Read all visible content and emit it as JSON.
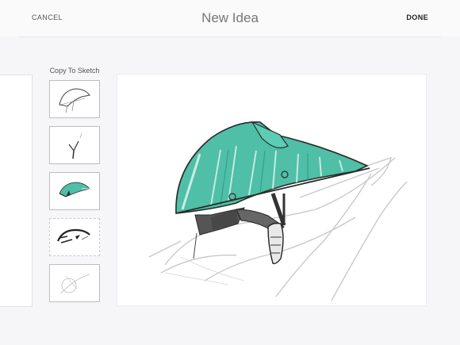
{
  "header": {
    "cancel_label": "CANCEL",
    "title": "New Idea",
    "done_label": "DONE"
  },
  "sidebar": {
    "copy_label": "Copy To Sketch",
    "thumbnails": [
      {
        "icon": "helmet-outline-sketch-icon"
      },
      {
        "icon": "strap-buckle-sketch-icon"
      },
      {
        "icon": "teal-helmet-sketch-icon"
      },
      {
        "icon": "helmet-black-sketch-icon"
      },
      {
        "icon": "faint-sketch-icon"
      }
    ]
  },
  "colors": {
    "teal": "#4fbfa7",
    "teal_dark": "#2e9a84",
    "ink": "#2a2a2a",
    "background": "#f6f6f8"
  }
}
